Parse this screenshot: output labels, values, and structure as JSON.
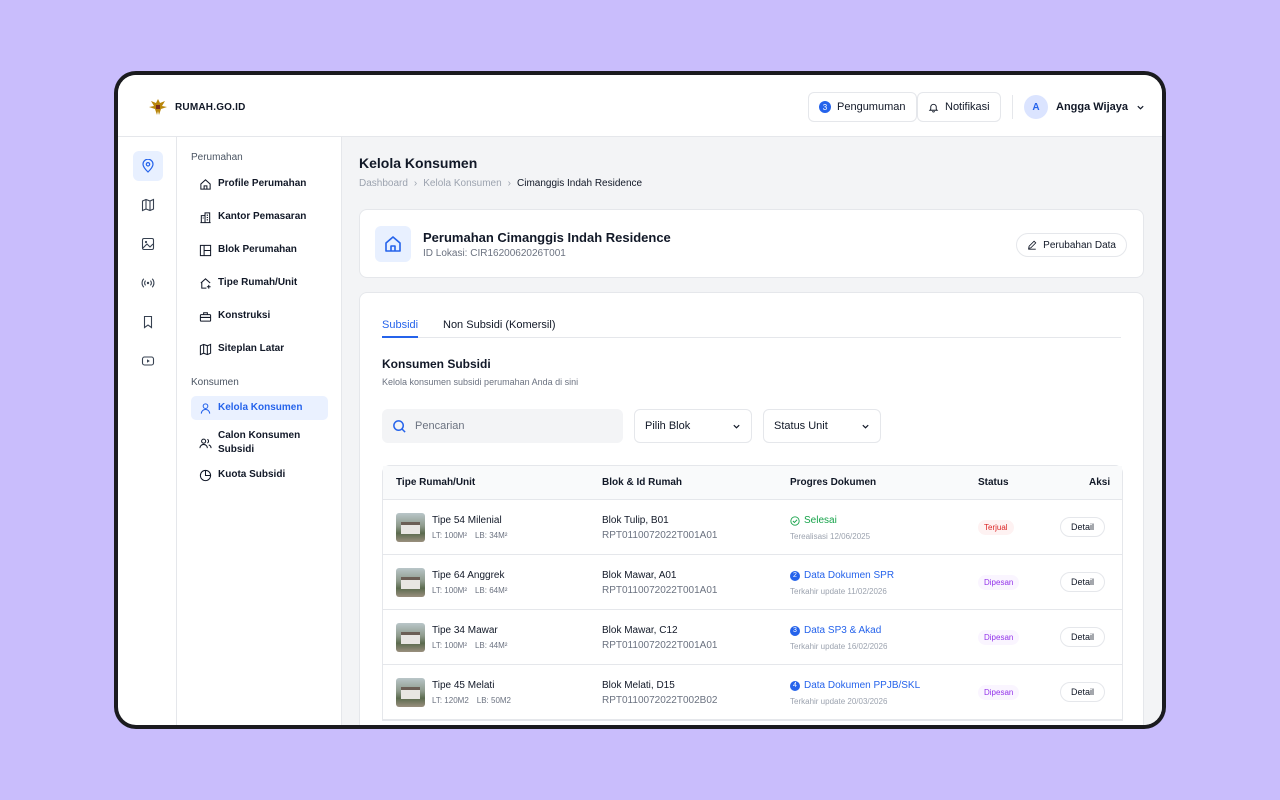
{
  "header": {
    "logo_text": "RUMAH.GO.ID",
    "announcements_count": "3",
    "announcements_label": "Pengumuman",
    "notifications_label": "Notifikasi",
    "user_initial": "A",
    "user_name": "Angga Wijaya"
  },
  "sidebar": {
    "section_housing": "Perumahan",
    "housing_items": [
      {
        "label": "Profile Perumahan"
      },
      {
        "label": "Kantor Pemasaran"
      },
      {
        "label": "Blok Perumahan"
      },
      {
        "label": "Tipe Rumah/Unit"
      },
      {
        "label": "Konstruksi"
      },
      {
        "label": "Siteplan Latar"
      }
    ],
    "section_consumer": "Konsumen",
    "consumer_items": [
      {
        "label": "Kelola Konsumen"
      },
      {
        "label": "Calon Konsumen Subsidi"
      },
      {
        "label": "Kuota Subsidi"
      }
    ]
  },
  "page": {
    "title": "Kelola Konsumen",
    "breadcrumb": [
      "Dashboard",
      "Kelola Konsumen",
      "Cimanggis Indah Residence"
    ]
  },
  "housing_card": {
    "title": "Perumahan Cimanggis Indah Residence",
    "location_id": "ID Lokasi: CIR1620062026T001",
    "edit_label": "Perubahan Data"
  },
  "tabs": [
    "Subsidi",
    "Non Subsidi (Komersil)"
  ],
  "section": {
    "title": "Konsumen Subsidi",
    "subtitle": "Kelola konsumen subsidi perumahan Anda di sini"
  },
  "filters": {
    "search_placeholder": "Pencarian",
    "block_select": "Pilih Blok",
    "status_select": "Status Unit"
  },
  "table": {
    "headers": [
      "Tipe Rumah/Unit",
      "Blok & Id Rumah",
      "Progres Dokumen",
      "Status",
      "Aksi"
    ],
    "rows": [
      {
        "type": "Tipe 54 Milenial",
        "lt": "LT: 100M²",
        "lb": "LB: 34M²",
        "blok": "Blok Tulip, B01",
        "house_id": "RPT0110072022T001A01",
        "progress_step": "",
        "progress": "Selesai",
        "progress_date": "Terealisasi 12/06/2025",
        "status": "Terjual",
        "action": "Detail",
        "done": true
      },
      {
        "type": "Tipe 64 Anggrek",
        "lt": "LT: 100M²",
        "lb": "LB: 64M²",
        "blok": "Blok Mawar, A01",
        "house_id": "RPT0110072022T001A01",
        "progress_step": "2",
        "progress": "Data Dokumen SPR",
        "progress_date": "Terkahir update 11/02/2026",
        "status": "Dipesan",
        "action": "Detail",
        "done": false
      },
      {
        "type": "Tipe 34 Mawar",
        "lt": "LT: 100M²",
        "lb": "LB: 44M²",
        "blok": "Blok Mawar, C12",
        "house_id": "RPT0110072022T001A01",
        "progress_step": "3",
        "progress": "Data SP3 & Akad",
        "progress_date": "Terkahir update 16/02/2026",
        "status": "Dipesan",
        "action": "Detail",
        "done": false
      },
      {
        "type": "Tipe 45 Melati",
        "lt": "LT: 120M2",
        "lb": "LB: 50M2",
        "blok": "Blok Melati, D15",
        "house_id": "RPT0110072022T002B02",
        "progress_step": "4",
        "progress": "Data Dokumen PPJB/SKL",
        "progress_date": "Terkahir update 20/03/2026",
        "status": "Dipesan",
        "action": "Detail",
        "done": false
      }
    ]
  },
  "colors": {
    "accent": "#2563eb",
    "background": "#c9bdfc",
    "success": "#16a34a",
    "sold": "#dc2626",
    "booked": "#9333ea"
  }
}
